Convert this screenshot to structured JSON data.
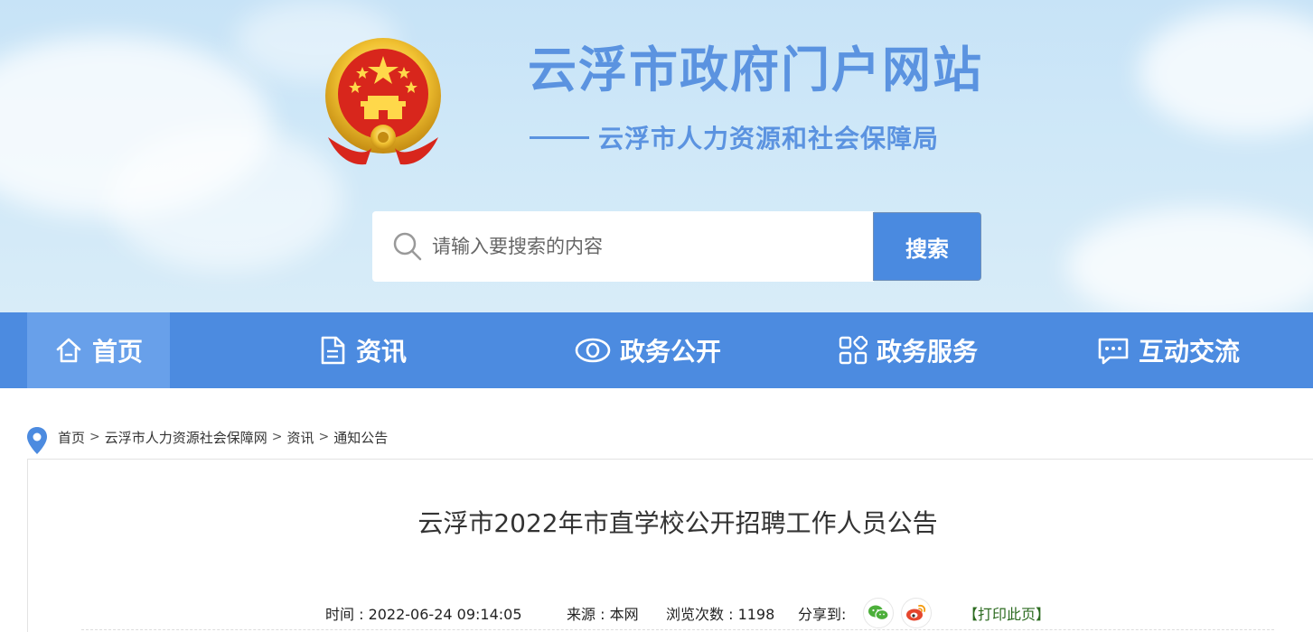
{
  "header": {
    "site_title": "云浮市政府门户网站",
    "site_subtitle": "云浮市人力资源和社会保障局"
  },
  "search": {
    "placeholder": "请输入要搜索的内容",
    "button_label": "搜索"
  },
  "nav": {
    "items": [
      {
        "label": "首页",
        "icon": "home-icon"
      },
      {
        "label": "资讯",
        "icon": "document-icon"
      },
      {
        "label": "政务公开",
        "icon": "eye-icon"
      },
      {
        "label": "政务服务",
        "icon": "grid-icon"
      },
      {
        "label": "互动交流",
        "icon": "chat-icon"
      }
    ],
    "active_index": 0
  },
  "breadcrumb": {
    "items": [
      "首页",
      "云浮市人力资源社会保障网",
      "资讯",
      "通知公告"
    ],
    "separator": ">"
  },
  "article": {
    "title": "云浮市2022年市直学校公开招聘工作人员公告",
    "time_label": "时间 : 2022-06-24 09:14:05",
    "source_label": "来源 : 本网",
    "views_label": "浏览次数 : 1198",
    "share_label": "分享到:",
    "share_icons": [
      "wechat-icon",
      "weibo-icon"
    ],
    "print_label": "【打印此页】"
  },
  "colors": {
    "brand_blue": "#4c8be0",
    "title_blue": "#5b93e0",
    "nav_active": "#68a0ea",
    "print_green": "#2b6a1f"
  }
}
